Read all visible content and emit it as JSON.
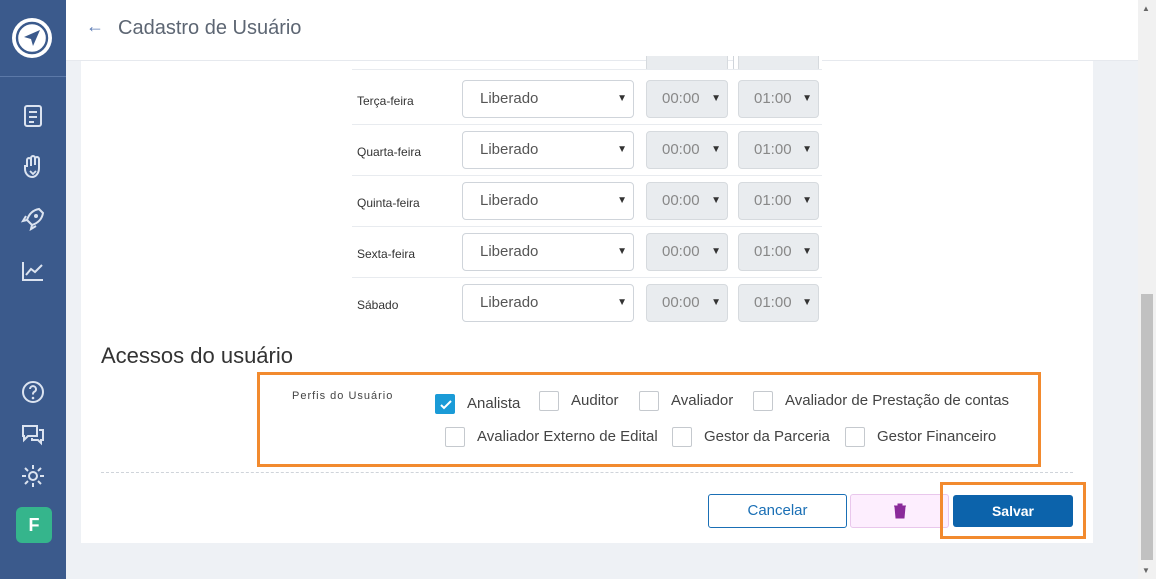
{
  "header": {
    "title": "Cadastro de Usuário"
  },
  "sidebar": {
    "logo_icon": "send-icon",
    "items": [
      {
        "icon": "document-icon"
      },
      {
        "icon": "hand-heart-icon"
      },
      {
        "icon": "rocket-icon"
      },
      {
        "icon": "chart-icon"
      }
    ],
    "footer": {
      "help_icon": "help-icon",
      "chat_icon": "chat-icon",
      "settings_icon": "settings-icon",
      "avatar_initial": "F"
    }
  },
  "schedule": {
    "rows": [
      {
        "day": "Terça-feira",
        "status": "Liberado",
        "start": "00:00",
        "end": "01:00"
      },
      {
        "day": "Quarta-feira",
        "status": "Liberado",
        "start": "00:00",
        "end": "01:00"
      },
      {
        "day": "Quinta-feira",
        "status": "Liberado",
        "start": "00:00",
        "end": "01:00"
      },
      {
        "day": "Sexta-feira",
        "status": "Liberado",
        "start": "00:00",
        "end": "01:00"
      },
      {
        "day": "Sábado",
        "status": "Liberado",
        "start": "00:00",
        "end": "01:00"
      }
    ]
  },
  "access": {
    "section_title": "Acessos do usuário",
    "profiles_label": "Perfis do Usuário",
    "profiles": [
      {
        "label": "Analista",
        "checked": true
      },
      {
        "label": "Auditor",
        "checked": false
      },
      {
        "label": "Avaliador",
        "checked": false
      },
      {
        "label": "Avaliador de Prestação de contas",
        "checked": false
      },
      {
        "label": "Avaliador Externo de Edital",
        "checked": false
      },
      {
        "label": "Gestor da Parceria",
        "checked": false
      },
      {
        "label": "Gestor Financeiro",
        "checked": false
      }
    ]
  },
  "actions": {
    "cancel": "Cancelar",
    "delete_icon": "trash-icon",
    "save": "Salvar"
  },
  "colors": {
    "sidebar": "#3b5a8c",
    "primary": "#0c63ab",
    "highlight": "#f28a2e",
    "checkbox": "#1a9bd7"
  }
}
